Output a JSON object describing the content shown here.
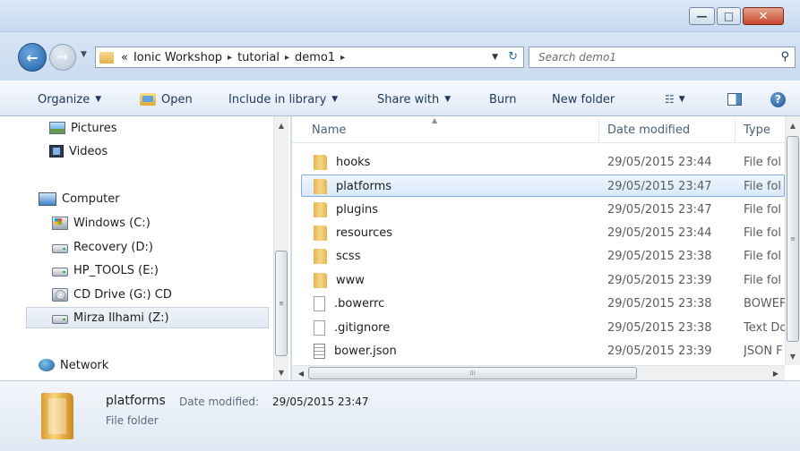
{
  "window": {
    "minimize_glyph": "—",
    "maximize_glyph": "□",
    "close_glyph": "✕"
  },
  "address": {
    "breadcrumb_prefix": "«",
    "crumbs": [
      "Ionic Workshop",
      "tutorial",
      "demo1"
    ],
    "separator": "▸"
  },
  "search": {
    "placeholder": "Search demo1"
  },
  "toolbar": {
    "organize": "Organize",
    "open": "Open",
    "include_in_library": "Include in library",
    "share_with": "Share with",
    "burn": "Burn",
    "new_folder": "New folder"
  },
  "navpane": {
    "pictures": "Pictures",
    "videos": "Videos",
    "computer": "Computer",
    "windows_c": "Windows (C:)",
    "recovery_d": "Recovery (D:)",
    "hp_tools_e": "HP_TOOLS (E:)",
    "cd_drive_g": "CD Drive (G:) CD",
    "mirza_z": "Mirza Ilhami (Z:)",
    "network": "Network"
  },
  "columns": {
    "name": "Name",
    "date_modified": "Date modified",
    "type": "Type"
  },
  "files": [
    {
      "name": "hooks",
      "date": "29/05/2015 23:44",
      "type": "File fol",
      "kind": "folder"
    },
    {
      "name": "platforms",
      "date": "29/05/2015 23:47",
      "type": "File fol",
      "kind": "folder"
    },
    {
      "name": "plugins",
      "date": "29/05/2015 23:47",
      "type": "File fol",
      "kind": "folder"
    },
    {
      "name": "resources",
      "date": "29/05/2015 23:44",
      "type": "File fol",
      "kind": "folder"
    },
    {
      "name": "scss",
      "date": "29/05/2015 23:38",
      "type": "File fol",
      "kind": "folder"
    },
    {
      "name": "www",
      "date": "29/05/2015 23:39",
      "type": "File fol",
      "kind": "folder"
    },
    {
      "name": ".bowerrc",
      "date": "29/05/2015 23:38",
      "type": "BOWEF",
      "kind": "file"
    },
    {
      "name": ".gitignore",
      "date": "29/05/2015 23:38",
      "type": "Text Do",
      "kind": "file"
    },
    {
      "name": "bower.json",
      "date": "29/05/2015 23:39",
      "type": "JSON F",
      "kind": "json"
    }
  ],
  "details": {
    "name": "platforms",
    "date_label": "Date modified:",
    "date_value": "29/05/2015 23:47",
    "type": "File folder"
  },
  "colors": {
    "chrome": "#c9dbee",
    "selection_border": "#84acdd",
    "toolbar_text": "#1e395b"
  }
}
